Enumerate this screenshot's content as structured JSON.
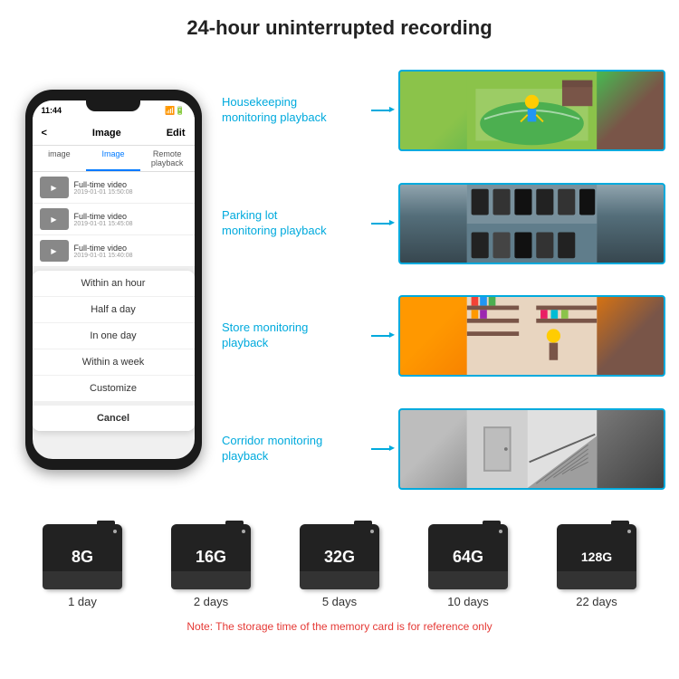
{
  "header": {
    "title": "24-hour uninterrupted recording"
  },
  "phone": {
    "status_time": "11:44",
    "nav_back": "<",
    "nav_title": "Image",
    "nav_edit": "Edit",
    "tabs": [
      {
        "label": "image",
        "active": false
      },
      {
        "label": "Image",
        "active": true
      },
      {
        "label": "Remote playback",
        "active": false
      }
    ],
    "list_items": [
      {
        "title": "Full-time video",
        "time": "2019-01-01 15:50:08"
      },
      {
        "title": "Full-time video",
        "time": "2019-01-01 15:45:08"
      },
      {
        "title": "Full-time video",
        "time": "2019-01-01 15:40:08"
      }
    ],
    "dropdown_items": [
      "Within an hour",
      "Half a day",
      "In one day",
      "Within a week",
      "Customize"
    ],
    "cancel_label": "Cancel"
  },
  "monitoring": [
    {
      "label": "Housekeeping\nmonitoring playback",
      "img_class": "img-housekeeping"
    },
    {
      "label": "Parking lot\nmonitoring playback",
      "img_class": "img-parking"
    },
    {
      "label": "Store monitoring\nplayback",
      "img_class": "img-store"
    },
    {
      "label": "Corridor monitoring\nplayback",
      "img_class": "img-corridor"
    }
  ],
  "storage_cards": [
    {
      "capacity": "8G",
      "days": "1 day"
    },
    {
      "capacity": "16G",
      "days": "2 days"
    },
    {
      "capacity": "32G",
      "days": "5 days"
    },
    {
      "capacity": "64G",
      "days": "10 days"
    },
    {
      "capacity": "128G",
      "days": "22 days"
    }
  ],
  "note": "Note: The storage time of the memory card is for reference only"
}
